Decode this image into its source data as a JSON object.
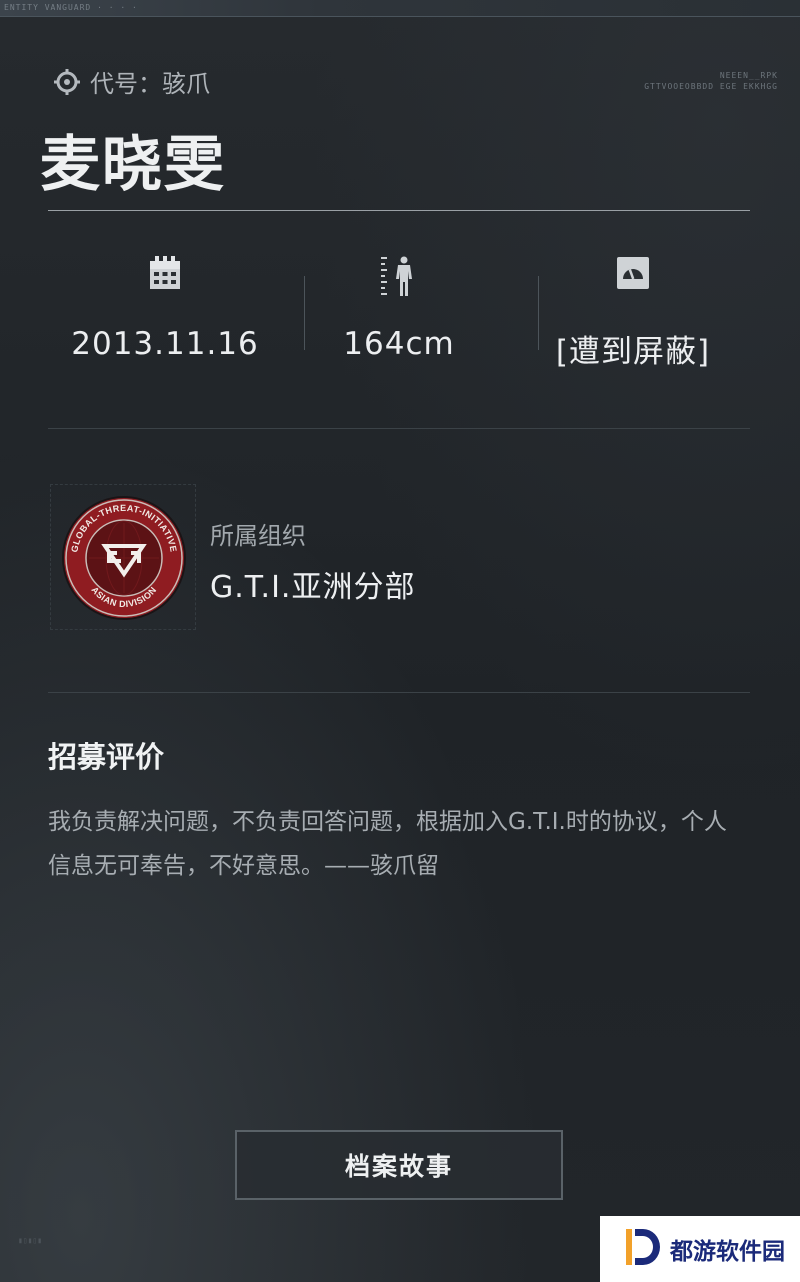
{
  "top_strip": "ENTITY VANGUARD  ·  ·  ·  ·",
  "profile": {
    "codename_label": "代号：骇爪",
    "name": "麦晓雯",
    "hud_code": "NEEEN__RPK\nGTTVOOEOBBDD EGE EKKHGG"
  },
  "stats": [
    {
      "icon": "calendar-icon",
      "value": "2013.11.16"
    },
    {
      "icon": "body-height-icon",
      "value": "164cm"
    },
    {
      "icon": "gauge-icon",
      "value": "[遭到屏蔽]"
    }
  ],
  "organization": {
    "label": "所属组织",
    "value": "G.T.I.亚洲分部",
    "emblem_ring_top": "GLOBAL-THREAT-INITIATIVE",
    "emblem_ring_bottom": "ASIAN DIVISION"
  },
  "recruit": {
    "heading": "招募评价",
    "text": "我负责解决问题，不负责回答问题，根据加入G.T.I.时的协议，个人信息无可奉告，不好意思。——骇爪留"
  },
  "buttons": {
    "story": "档案故事"
  },
  "watermark": {
    "text": "都游软件园"
  },
  "colors": {
    "background": "#202428",
    "emblem_red": "#9a1f24",
    "watermark_blue": "#1b2a7a"
  }
}
